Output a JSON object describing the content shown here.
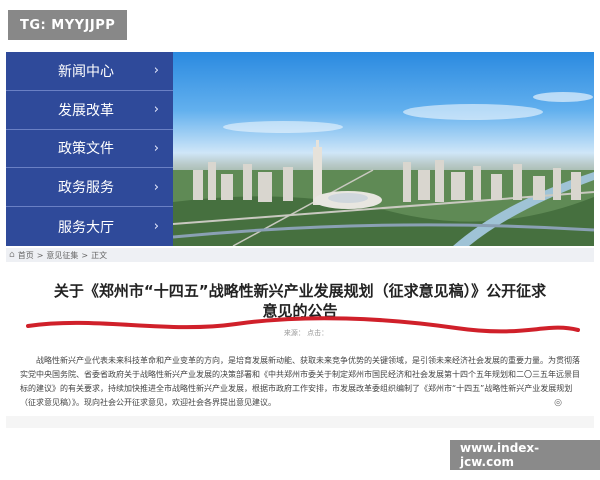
{
  "watermark": {
    "tag": "TG: MYYJJPP",
    "url": "www.index-jcw.com"
  },
  "sidebar": {
    "items": [
      {
        "label": "新闻中心",
        "chevron": "›"
      },
      {
        "label": "发展改革",
        "chevron": "›"
      },
      {
        "label": "政策文件",
        "chevron": "›"
      },
      {
        "label": "政务服务",
        "chevron": "›"
      },
      {
        "label": "服务大厅",
        "chevron": "›"
      }
    ]
  },
  "breadcrumb": {
    "home_icon": "home-icon",
    "home": "首页",
    "sep": ">",
    "section": "意见征集",
    "current": "正文"
  },
  "article": {
    "title_line1": "关于《郑州市“十四五”战略性新兴产业发展规划（征求意见稿）》公开征求",
    "title_line2": "意见的公告",
    "meta": "来源：    点击：",
    "body": "战略性新兴产业代表未来科技革命和产业变革的方向，是培育发展新动能、获取未来竞争优势的关键领域，是引领未来经济社会发展的重要力量。为贯彻落实党中央国务院、省委省政府关于战略性新兴产业发展的决策部署和《中共郑州市委关于制定郑州市国民经济和社会发展第十四个五年规划和二〇三五年远景目标的建议》的有关要求，持续加快推进全市战略性新兴产业发展，根据市政府工作安排，市发展改革委组织编制了《郑州市“十四五”战略性新兴产业发展规划（征求意见稿）》。现向社会公开征求意见，欢迎社会各界提出意见建议。"
  },
  "colors": {
    "sidebar": "#2f4a9a",
    "annotation_line": "#d0202a"
  }
}
